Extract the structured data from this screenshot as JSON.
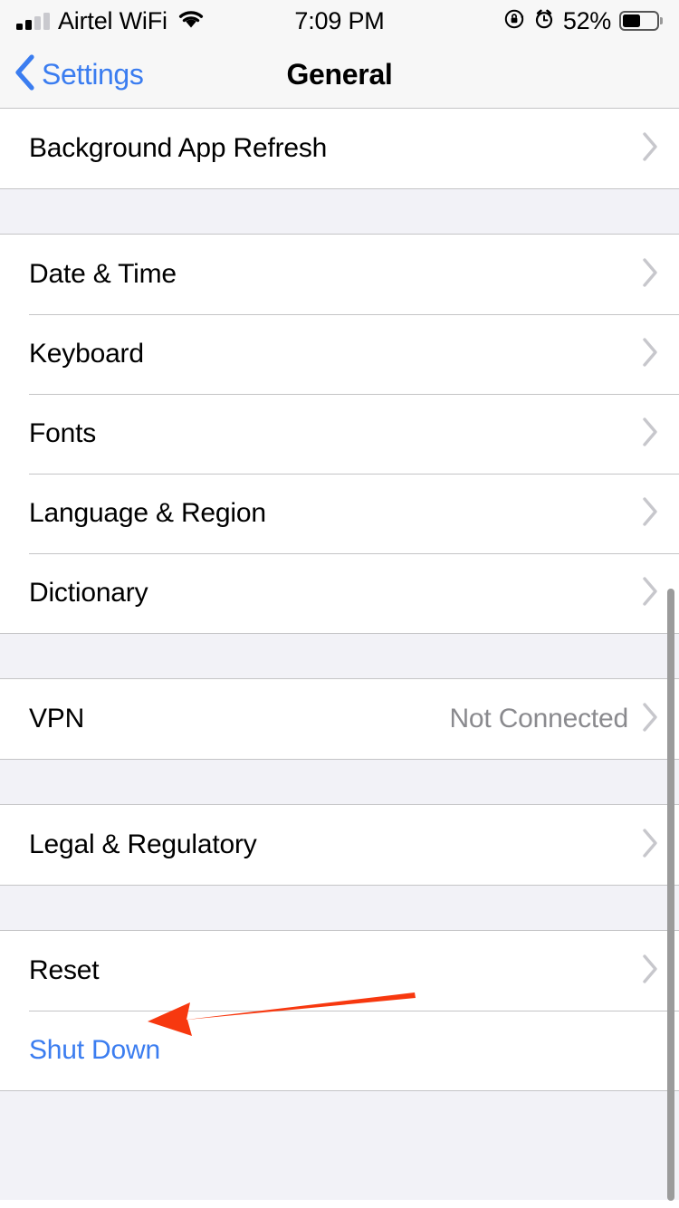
{
  "status_bar": {
    "carrier": "Airtel WiFi",
    "time": "7:09 PM",
    "battery_percent": "52%",
    "battery_level": 52,
    "signal_bars_filled": 2,
    "signal_bars_total": 4,
    "icons": [
      "signal-bars-icon",
      "wifi-icon",
      "rotation-lock-icon",
      "alarm-clock-icon",
      "battery-icon"
    ]
  },
  "nav_bar": {
    "back_label": "Settings",
    "title": "General"
  },
  "sections": [
    {
      "rows": [
        {
          "label": "Background App Refresh",
          "value": "",
          "accessory": "chevron",
          "style": "default"
        }
      ]
    },
    {
      "rows": [
        {
          "label": "Date & Time",
          "value": "",
          "accessory": "chevron",
          "style": "default"
        },
        {
          "label": "Keyboard",
          "value": "",
          "accessory": "chevron",
          "style": "default"
        },
        {
          "label": "Fonts",
          "value": "",
          "accessory": "chevron",
          "style": "default"
        },
        {
          "label": "Language & Region",
          "value": "",
          "accessory": "chevron",
          "style": "default"
        },
        {
          "label": "Dictionary",
          "value": "",
          "accessory": "chevron",
          "style": "default"
        }
      ]
    },
    {
      "rows": [
        {
          "label": "VPN",
          "value": "Not Connected",
          "accessory": "chevron",
          "style": "default"
        }
      ]
    },
    {
      "rows": [
        {
          "label": "Legal & Regulatory",
          "value": "",
          "accessory": "chevron",
          "style": "default"
        }
      ]
    },
    {
      "rows": [
        {
          "label": "Reset",
          "value": "",
          "accessory": "chevron",
          "style": "default"
        },
        {
          "label": "Shut Down",
          "value": "",
          "accessory": "none",
          "style": "link"
        }
      ]
    }
  ],
  "annotation": {
    "type": "arrow",
    "direction": "left",
    "points_to": "Reset",
    "color": "#f7380f"
  },
  "colors": {
    "accent_blue": "#3b7df0",
    "chevron_gray": "#c7c7cc",
    "separator": "#c4c4c6",
    "group_background": "#f2f2f7",
    "bar_background": "#f7f7f7",
    "value_gray": "#8a8a8e",
    "annotation_red": "#f7380f",
    "scrollbar": "#9b9b9b"
  }
}
